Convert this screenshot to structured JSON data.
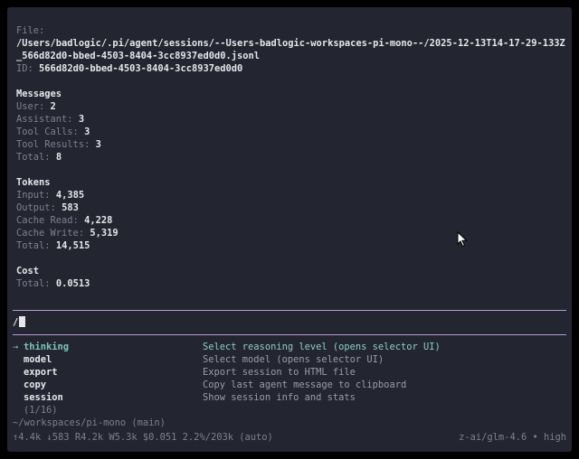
{
  "file": {
    "label": "File:",
    "path_line1": "/Users/badlogic/.pi/agent/sessions/--Users-badlogic-workspaces-pi-mono--/2025-12-13T14-17-29-133Z",
    "path_line2": "_566d82d0-bbed-4503-8404-3cc8937ed0d0.jsonl",
    "id_label": "ID:",
    "id_value": "566d82d0-bbed-4503-8404-3cc8937ed0d0"
  },
  "messages": {
    "heading": "Messages",
    "rows": [
      {
        "label": "User:",
        "value": "2"
      },
      {
        "label": "Assistant:",
        "value": "3"
      },
      {
        "label": "Tool Calls:",
        "value": "3"
      },
      {
        "label": "Tool Results:",
        "value": "3"
      },
      {
        "label": "Total:",
        "value": "8"
      }
    ]
  },
  "tokens": {
    "heading": "Tokens",
    "rows": [
      {
        "label": "Input:",
        "value": "4,385"
      },
      {
        "label": "Output:",
        "value": "583"
      },
      {
        "label": "Cache Read:",
        "value": "4,228"
      },
      {
        "label": "Cache Write:",
        "value": "5,319"
      },
      {
        "label": "Total:",
        "value": "14,515"
      }
    ]
  },
  "cost": {
    "heading": "Cost",
    "rows": [
      {
        "label": "Total:",
        "value": "0.0513"
      }
    ]
  },
  "input": {
    "value": "/"
  },
  "commands": [
    {
      "arrow": "→",
      "name": "thinking",
      "desc": "Select reasoning level (opens selector UI)"
    },
    {
      "arrow": "",
      "name": "model",
      "desc": "Select model (opens selector UI)"
    },
    {
      "arrow": "",
      "name": "export",
      "desc": "Export session to HTML file"
    },
    {
      "arrow": "",
      "name": "copy",
      "desc": "Copy last agent message to clipboard"
    },
    {
      "arrow": "",
      "name": "session",
      "desc": "Show session info and stats"
    }
  ],
  "commands_count": "(1/16)",
  "footer": {
    "cwd": "~/workspaces/pi-mono (main)",
    "stats": "↑4.4k ↓583 R4.2k W5.3k $0.051 2.2%/203k (auto)",
    "model": "z-ai/glm-4.6 • high"
  },
  "colors": {
    "background": "#232530",
    "separator": "#b39ad6",
    "accent": "#7fc5b8"
  },
  "icons": {
    "mouse_pointer": "mouse-pointer-icon"
  }
}
